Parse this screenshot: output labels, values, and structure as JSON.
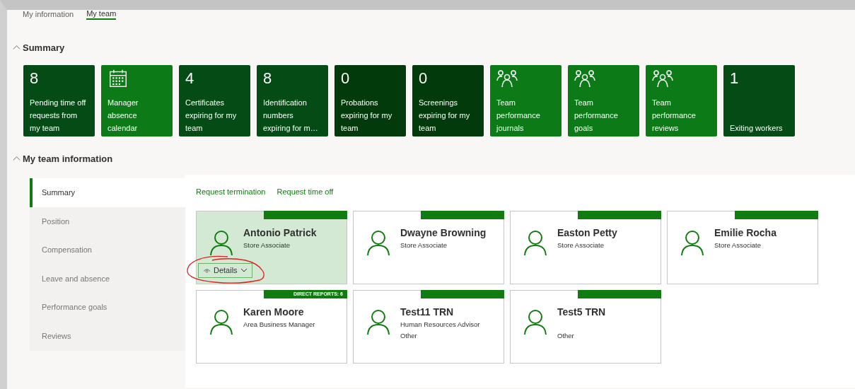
{
  "tabs": [
    {
      "label": "My information",
      "selected": false
    },
    {
      "label": "My team",
      "selected": true
    }
  ],
  "summary": {
    "heading": "Summary",
    "expanded": true,
    "tiles": [
      {
        "kind": "count",
        "value": "8",
        "label": "Pending time off requests from my team",
        "color": "#054b16"
      },
      {
        "kind": "calendar",
        "label": "Manager absence calendar",
        "color": "#0b7a17"
      },
      {
        "kind": "count",
        "value": "4",
        "label": "Certificates expiring for my team",
        "color": "#054b16"
      },
      {
        "kind": "count",
        "value": "8",
        "label": "Identification numbers expiring for m…",
        "color": "#054b16"
      },
      {
        "kind": "count",
        "value": "0",
        "label": "Probations expiring for my team",
        "color": "#033a0c"
      },
      {
        "kind": "count",
        "value": "0",
        "label": "Screenings expiring for my team",
        "color": "#033a0c"
      },
      {
        "kind": "team",
        "label": "Team performance journals",
        "color": "#0b7a17"
      },
      {
        "kind": "team",
        "label": "Team performance goals",
        "color": "#0b7a17"
      },
      {
        "kind": "team",
        "label": "Team performance reviews",
        "color": "#0b7a17"
      },
      {
        "kind": "count",
        "value": "1",
        "label": "Exiting workers",
        "color": "#054b16"
      }
    ]
  },
  "team_info": {
    "heading": "My team information",
    "expanded": true,
    "nav": [
      {
        "label": "Summary",
        "selected": true
      },
      {
        "label": "Position",
        "selected": false
      },
      {
        "label": "Compensation",
        "selected": false
      },
      {
        "label": "Leave and absence",
        "selected": false
      },
      {
        "label": "Performance goals",
        "selected": false
      },
      {
        "label": "Reviews",
        "selected": false
      }
    ],
    "actions": [
      "Request termination",
      "Request time off"
    ],
    "cards": [
      {
        "name": "Antonio Patrick",
        "title": "Store Associate",
        "selected": true,
        "details": "Details",
        "circled": true
      },
      {
        "name": "Dwayne Browning",
        "title": "Store Associate",
        "selected": false
      },
      {
        "name": "Easton Petty",
        "title": "Store Associate",
        "selected": false
      },
      {
        "name": "Emilie Rocha",
        "title": "Store Associate",
        "selected": false
      },
      {
        "name": "Karen Moore",
        "title": "Area Business Manager",
        "selected": false,
        "badge": "DIRECT REPORTS: 6"
      },
      {
        "name": "Test11 TRN",
        "title": "Human Resources Advisor",
        "extra": "Other",
        "selected": false
      },
      {
        "name": "Test5 TRN",
        "extra": "Other",
        "selected": false
      }
    ]
  }
}
